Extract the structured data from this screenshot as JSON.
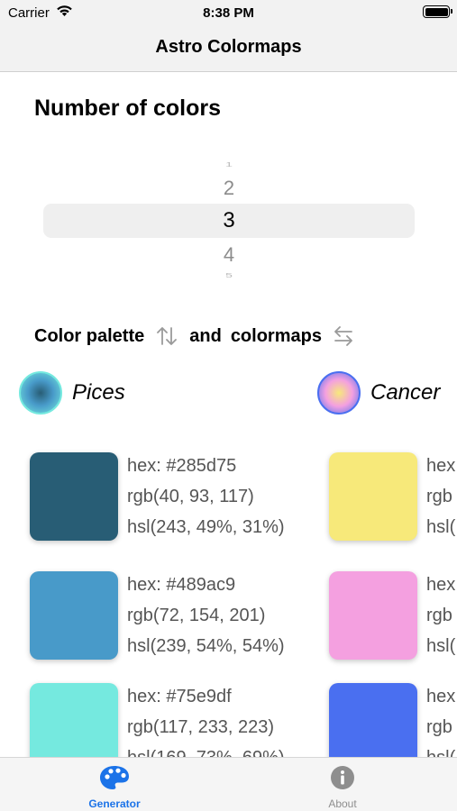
{
  "status_bar": {
    "carrier": "Carrier",
    "time": "8:38 PM"
  },
  "nav": {
    "title": "Astro Colormaps"
  },
  "section": {
    "title": "Number of colors"
  },
  "picker": {
    "values": [
      "1",
      "2",
      "3",
      "4",
      "5"
    ],
    "selected": "3"
  },
  "palette_row": {
    "palette_label": "Color palette",
    "and_label": "and",
    "colormaps_label": "colormaps"
  },
  "signs": [
    {
      "name": "Pices",
      "colors": [
        {
          "swatch": "#285d75",
          "hex": "hex: #285d75",
          "rgb": "rgb(40, 93, 117)",
          "hsl": "hsl(243, 49%, 31%)"
        },
        {
          "swatch": "#489ac9",
          "hex": "hex: #489ac9",
          "rgb": "rgb(72, 154, 201)",
          "hsl": "hsl(239, 54%, 54%)"
        },
        {
          "swatch": "#75e9df",
          "hex": "hex: #75e9df",
          "rgb": "rgb(117, 233, 223)",
          "hsl": "hsl(169, 73%, 69%)"
        }
      ]
    },
    {
      "name": "Cancer",
      "colors": [
        {
          "swatch": "#f7e97a",
          "hex": "hex",
          "rgb": "rgb",
          "hsl": "hsl("
        },
        {
          "swatch": "#f4a0e0",
          "hex": "hex",
          "rgb": "rgb",
          "hsl": "hsl("
        },
        {
          "swatch": "#4a6ff0",
          "hex": "hex",
          "rgb": "rgb",
          "hsl": "hsl("
        }
      ]
    }
  ],
  "tabs": [
    {
      "label": "Generator",
      "icon": "palette-icon",
      "active": true
    },
    {
      "label": "About",
      "icon": "info-icon",
      "active": false
    }
  ],
  "colors": {
    "accent": "#1c73e8",
    "inactive": "#8e8e8e"
  }
}
